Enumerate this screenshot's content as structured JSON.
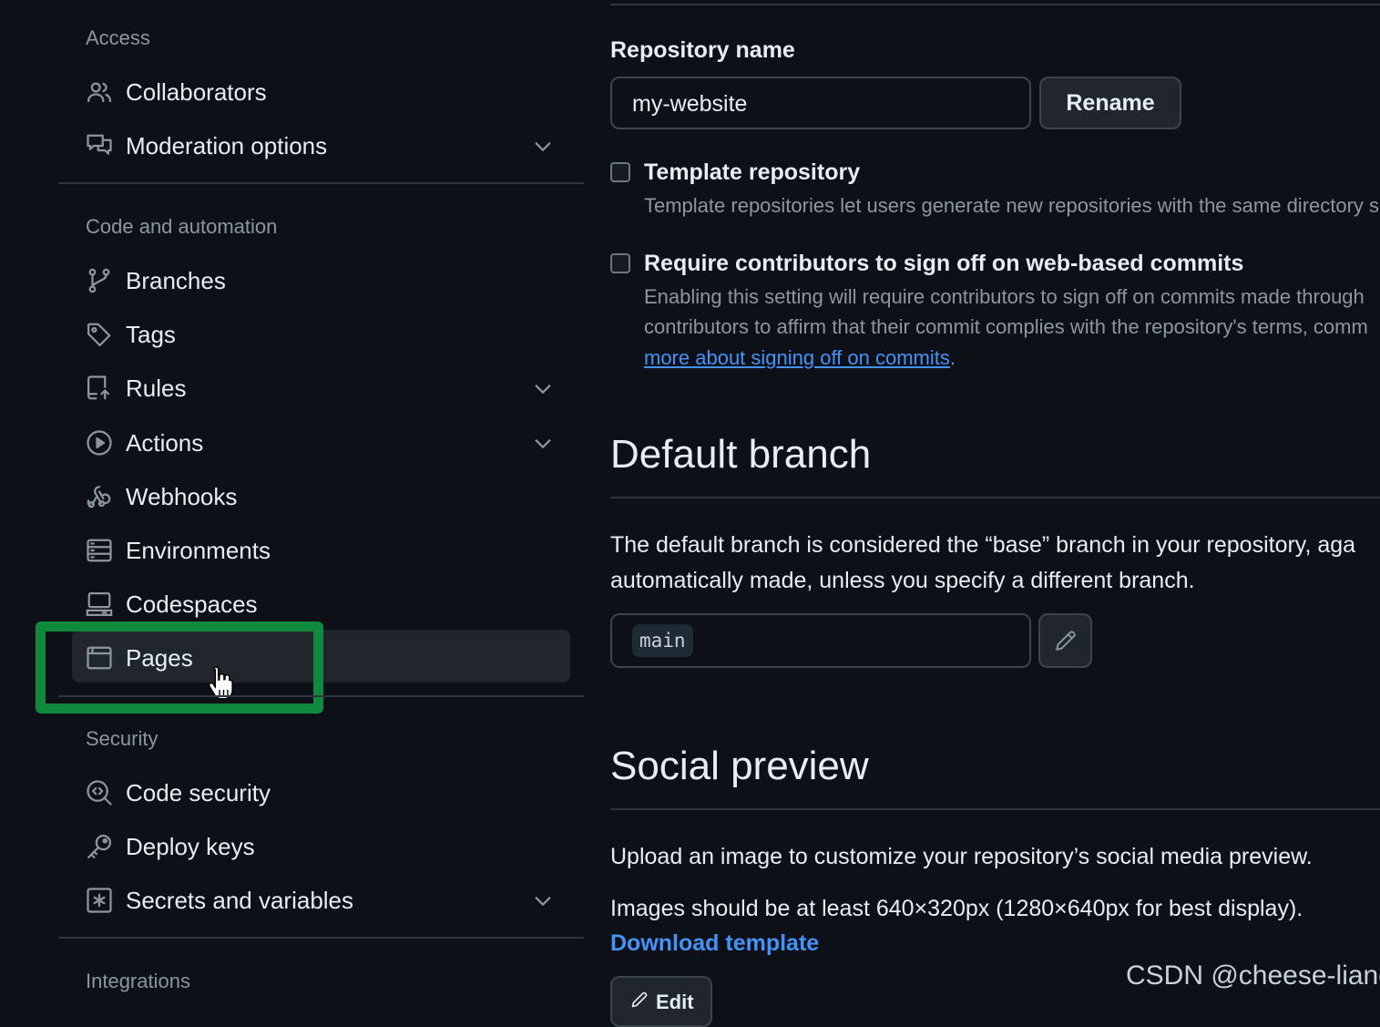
{
  "sidebar": {
    "sections": [
      {
        "heading": "Access"
      },
      {
        "heading": "Code and automation"
      },
      {
        "heading": "Security"
      },
      {
        "heading": "Integrations"
      }
    ],
    "items": [
      {
        "label": "Collaborators",
        "icon": "people-icon"
      },
      {
        "label": "Moderation options",
        "icon": "comment-discussion-icon"
      },
      {
        "label": "Branches",
        "icon": "git-branch-icon"
      },
      {
        "label": "Tags",
        "icon": "tag-icon"
      },
      {
        "label": "Rules",
        "icon": "repo-push-icon"
      },
      {
        "label": "Actions",
        "icon": "play-icon"
      },
      {
        "label": "Webhooks",
        "icon": "webhook-icon"
      },
      {
        "label": "Environments",
        "icon": "server-icon"
      },
      {
        "label": "Codespaces",
        "icon": "codespaces-icon"
      },
      {
        "label": "Pages",
        "icon": "browser-icon"
      },
      {
        "label": "Code security",
        "icon": "codescan-icon"
      },
      {
        "label": "Deploy keys",
        "icon": "key-icon"
      },
      {
        "label": "Secrets and variables",
        "icon": "key-asterisk-icon"
      }
    ],
    "active_item": "Pages"
  },
  "main": {
    "repo_name_label": "Repository name",
    "repo_name_value": "my-website",
    "rename_button": "Rename",
    "template": {
      "label": "Template repository",
      "desc": "Template repositories let users generate new repositories with the same directory s",
      "checked": false
    },
    "signoff": {
      "label": "Require contributors to sign off on web-based commits",
      "desc_line1": "Enabling this setting will require contributors to sign off on commits made through",
      "desc_line2": "contributors to affirm that their commit complies with the repository's terms, comm",
      "link": "more about signing off on commits",
      "trail": ".",
      "checked": false
    },
    "default_branch": {
      "title": "Default branch",
      "para_line1": "The default branch is considered the “base” branch in your repository, aga",
      "para_line2": "automatically made, unless you specify a different branch.",
      "branch": "main"
    },
    "social_preview": {
      "title": "Social preview",
      "para1": "Upload an image to customize your repository’s social media preview.",
      "para2": "Images should be at least 640×320px (1280×640px for best display).",
      "download_link": "Download template",
      "edit_button": "Edit"
    }
  },
  "watermark": "CSDN @cheese-liang",
  "colors": {
    "background": "#0d1117",
    "link": "#4493f8",
    "highlight": "#0f8a3c"
  }
}
